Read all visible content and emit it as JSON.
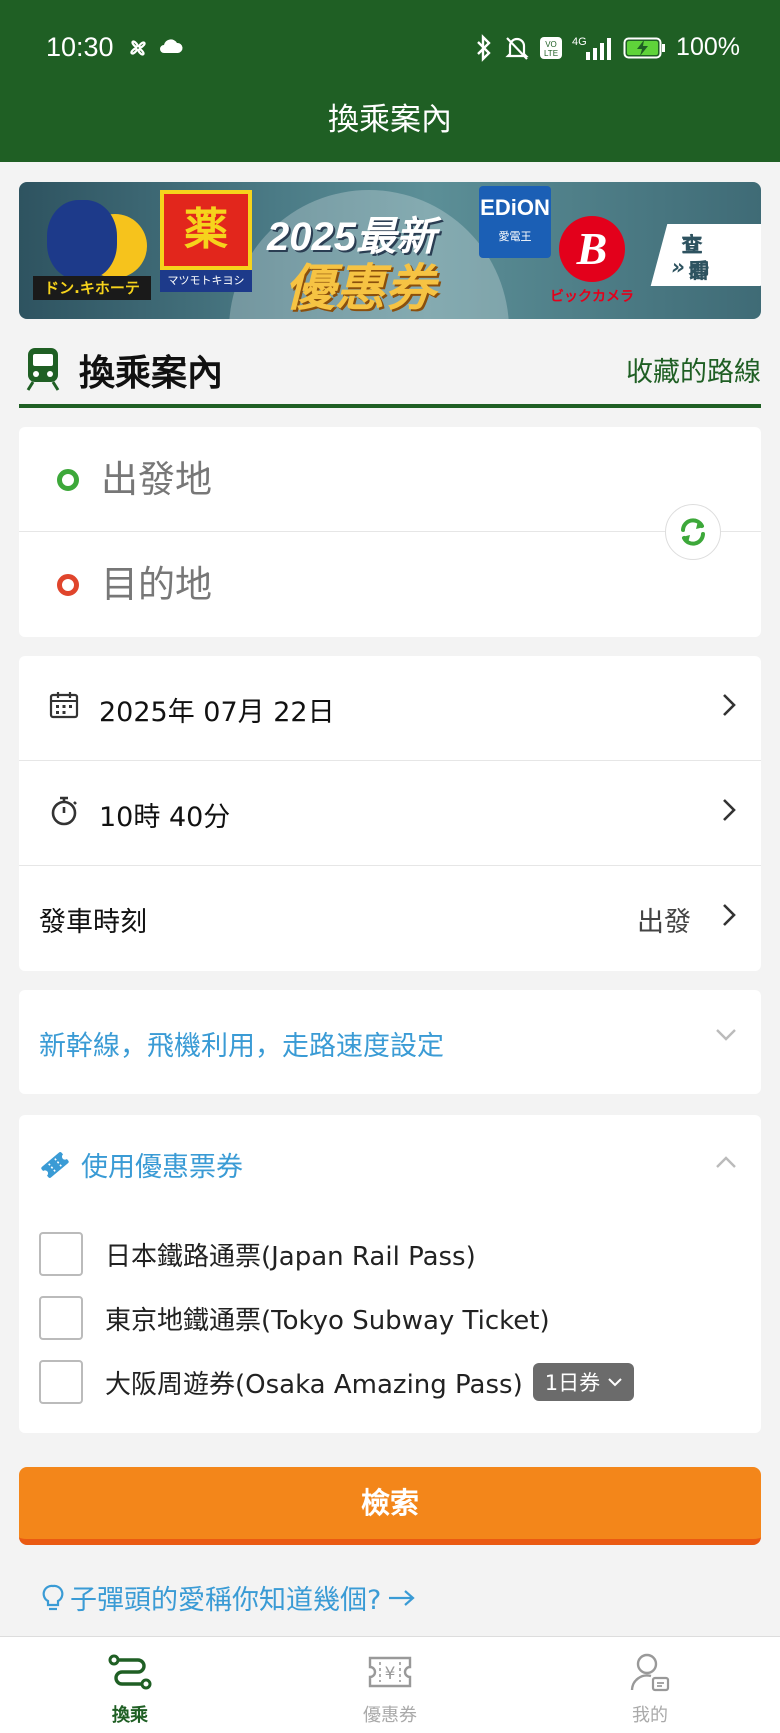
{
  "status_bar": {
    "time": "10:30",
    "battery": "100%",
    "network": "4G"
  },
  "app_bar": {
    "title": "換乘案內"
  },
  "banner": {
    "year_text": "2025最新",
    "coupon_text": "優惠券",
    "drug_text": "薬",
    "drug_sub": "マツモトキヨシ",
    "donki_label": "ドン.キホーテ",
    "edion_text": "EDiON",
    "edion_sub": "愛電王",
    "bic_text": "B",
    "bic_label": "ビックカメラ",
    "cta_line1": "立即",
    "cta_line2": "查看"
  },
  "section": {
    "title": "換乘案內",
    "favorites_link": "收藏的路線"
  },
  "route": {
    "origin_placeholder": "出發地",
    "destination_placeholder": "目的地"
  },
  "datetime": {
    "date": "2025年 07月 22日",
    "time": "10時 40分",
    "departure_label": "發車時刻",
    "departure_value": "出發"
  },
  "options": {
    "label": "新幹線，飛機利用，走路速度設定"
  },
  "passes": {
    "title": "使用優惠票券",
    "items": [
      {
        "label": "日本鐵路通票(Japan Rail Pass)"
      },
      {
        "label": "東京地鐵通票(Tokyo Subway Ticket)"
      },
      {
        "label": "大阪周遊券(Osaka Amazing Pass)",
        "badge": "1日券"
      }
    ]
  },
  "search_button": {
    "label": "檢索"
  },
  "tip": {
    "text": "子彈頭的愛稱你知道幾個?"
  },
  "bottom_nav": {
    "items": [
      {
        "label": "換乘"
      },
      {
        "label": "優惠券"
      },
      {
        "label": "我的"
      }
    ]
  },
  "colors": {
    "brand_green": "#1f5f24",
    "accent_orange": "#f3861a",
    "link_blue": "#3a9bd5",
    "origin_green": "#3da83a",
    "destination_red": "#e0452c"
  }
}
